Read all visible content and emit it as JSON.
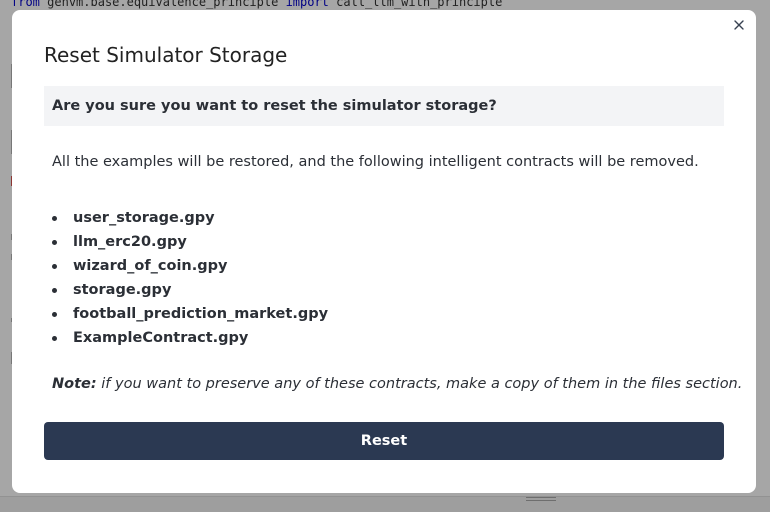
{
  "background_editor": {
    "code_line": {
      "kw_from": "from",
      "module": "genvm.base.equivalence_principle",
      "kw_import": "import",
      "name": "call_llm_with_principle"
    }
  },
  "dialog": {
    "title": "Reset Simulator Storage",
    "close_icon": "close-icon",
    "question": "Are you sure you want to reset the simulator storage?",
    "description": "All the examples will be restored, and the following intelligent contracts will be removed.",
    "contracts": [
      "user_storage.gpy",
      "llm_erc20.gpy",
      "wizard_of_coin.gpy",
      "storage.gpy",
      "football_prediction_market.gpy",
      "ExampleContract.gpy"
    ],
    "note_label": "Note:",
    "note_text": " if you want to preserve any of these contracts, make a copy of them in the files section.",
    "reset_label": "Reset"
  },
  "colors": {
    "overlay": "rgba(0,0,0,0.35)",
    "button_bg": "#2b3952",
    "question_bg": "#f3f4f6",
    "text": "#2b2f36"
  }
}
